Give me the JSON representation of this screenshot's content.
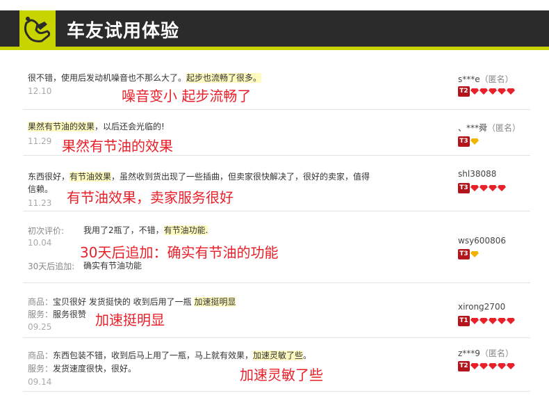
{
  "header": {
    "title": "车友试用体验"
  },
  "reviews": [
    {
      "text_a": "很不错，使用后发动机噪音也不那么大了。",
      "text_hl": "起步也流畅了很多。",
      "date": "12.10",
      "overlay": "噪音变小  起步流畅了",
      "user": "s***e",
      "anon": "（匿名）",
      "rank": "T2",
      "gems": 5,
      "gem_color": "#e8202a"
    },
    {
      "text_hl": "果然有节油的效果",
      "text_b": "，以后还会光临的!",
      "date": "11.29",
      "overlay": "果然有节油的效果",
      "user": "、***舜",
      "anon": "（匿名）",
      "rank": "T3",
      "gems": 1,
      "gem_color": "#f2b300"
    },
    {
      "text_a": "东西很好，",
      "text_hl": "有节油效果",
      "text_b": "，虽然收到货出现了一些插曲，但卖家很快解决了，很好的卖家，值得",
      "text_line2": "信赖。",
      "date": "11.23",
      "overlay": "有节油效果，卖家服务很好",
      "user": "shl38088",
      "rank": "T3",
      "gems": 4,
      "gem_color": "#e8202a"
    },
    {
      "label_first": "初次评价:",
      "text_a": "我用了2瓶了，不错，",
      "text_hl": "有节油功能.",
      "date": "10.04",
      "overlay": "30天后追加：确实有节油的功能",
      "label_follow": "30天后追加:",
      "text_follow": "确实有节油功能",
      "user": "wsy600806",
      "rank": "T3",
      "gems": 1,
      "gem_color": "#f2b300"
    },
    {
      "label_goods": "商品：",
      "text_a": "宝贝很好 发货挺快的 收到后用了一瓶 ",
      "text_hl": "加速挺明显",
      "label_service": "服务：",
      "text_service": "服务很赞",
      "date": "09.25",
      "overlay": "加速挺明显",
      "user": "xirong2700",
      "rank": "T1",
      "gems": 5,
      "gem_color": "#e8202a"
    },
    {
      "label_goods": "商品：",
      "text_a": "东西包装不错，收到后马上用了一瓶，马上就有效果，",
      "text_hl": "加速灵敏了些",
      "text_b": "。",
      "label_service": "服务：",
      "text_service": "发货速度很快，很好。",
      "date": "09.14",
      "overlay": "加速灵敏了些",
      "user": "z***9",
      "anon": "（匿名）",
      "rank": "T2",
      "gems": 5,
      "gem_color": "#e8202a"
    }
  ]
}
